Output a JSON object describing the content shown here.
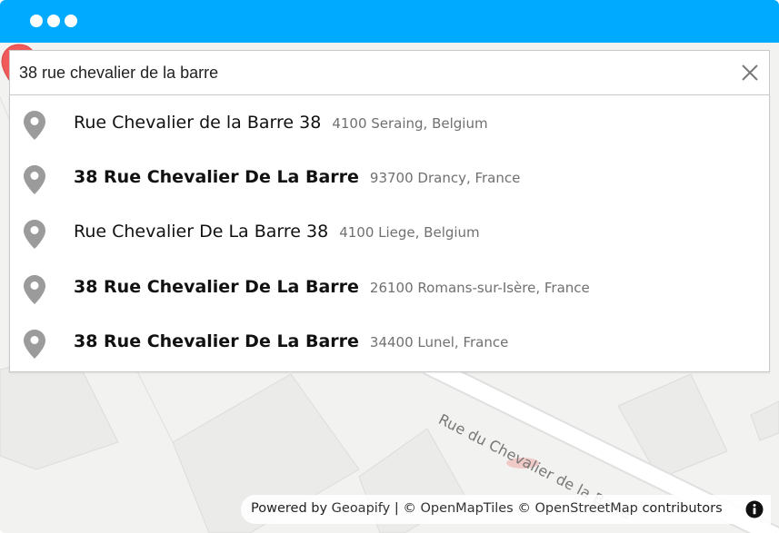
{
  "window": {
    "controls": [
      "dot",
      "dot",
      "dot"
    ],
    "titlebar_color": "#00aaff"
  },
  "search": {
    "value": "38 rue chevalier de la barre",
    "clear_icon": "close-icon"
  },
  "suggestions": [
    {
      "main": "Rue Chevalier de la Barre 38",
      "secondary": "4100 Seraing, Belgium",
      "bold": false,
      "icon": "map-pin-icon"
    },
    {
      "main": "38 Rue Chevalier De La Barre",
      "secondary": "93700 Drancy, France",
      "bold": true,
      "icon": "map-pin-icon"
    },
    {
      "main": "Rue Chevalier De La Barre 38",
      "secondary": "4100 Liege, Belgium",
      "bold": false,
      "icon": "map-pin-icon"
    },
    {
      "main": "38 Rue Chevalier De La Barre",
      "secondary": "26100 Romans-sur-Isère, France",
      "bold": true,
      "icon": "map-pin-icon"
    },
    {
      "main": "38 Rue Chevalier De La Barre",
      "secondary": "34400 Lunel, France",
      "bold": true,
      "icon": "map-pin-icon"
    }
  ],
  "map": {
    "street_label": "Rue du Chevalier de la Barre",
    "marker_color": "#f05a5a"
  },
  "attribution": {
    "powered_by": "Powered by ",
    "geoapify": "Geoapify",
    "sep1": " | © ",
    "openmaptiles": "OpenMapTiles",
    "sep2": " © ",
    "openstreetmap": "OpenStreetMap",
    "contributors": " contributors",
    "info_icon": "info-icon"
  }
}
